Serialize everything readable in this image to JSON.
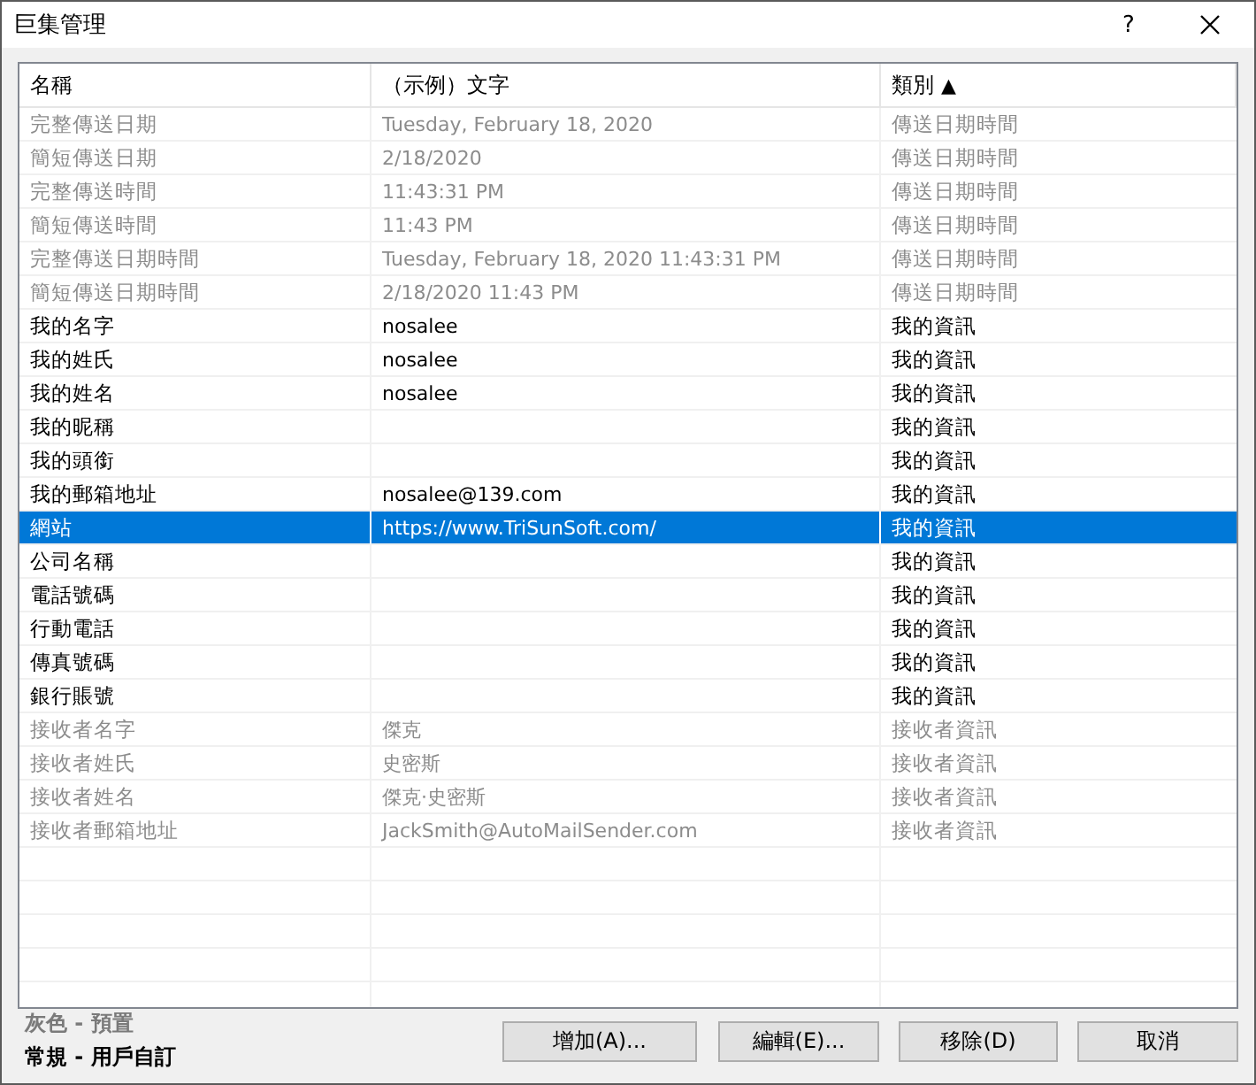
{
  "window": {
    "title": "巨集管理",
    "help": "?"
  },
  "table": {
    "columns": [
      {
        "label": "名稱"
      },
      {
        "label": "（示例）文字"
      },
      {
        "label": "類別",
        "sort_indicator": "▲"
      }
    ],
    "rows": [
      {
        "cells": [
          "完整傳送日期",
          "Tuesday, February 18, 2020",
          "傳送日期時間"
        ],
        "preset": true,
        "selected": false
      },
      {
        "cells": [
          "簡短傳送日期",
          "2/18/2020",
          "傳送日期時間"
        ],
        "preset": true,
        "selected": false
      },
      {
        "cells": [
          "完整傳送時間",
          "11:43:31 PM",
          "傳送日期時間"
        ],
        "preset": true,
        "selected": false
      },
      {
        "cells": [
          "簡短傳送時間",
          "11:43 PM",
          "傳送日期時間"
        ],
        "preset": true,
        "selected": false
      },
      {
        "cells": [
          "完整傳送日期時間",
          "Tuesday, February 18, 2020 11:43:31 PM",
          "傳送日期時間"
        ],
        "preset": true,
        "selected": false
      },
      {
        "cells": [
          "簡短傳送日期時間",
          "2/18/2020 11:43 PM",
          "傳送日期時間"
        ],
        "preset": true,
        "selected": false
      },
      {
        "cells": [
          "我的名字",
          "nosalee",
          "我的資訊"
        ],
        "preset": false,
        "selected": false
      },
      {
        "cells": [
          "我的姓氏",
          "nosalee",
          "我的資訊"
        ],
        "preset": false,
        "selected": false
      },
      {
        "cells": [
          "我的姓名",
          "nosalee",
          "我的資訊"
        ],
        "preset": false,
        "selected": false
      },
      {
        "cells": [
          "我的昵稱",
          null,
          "我的資訊"
        ],
        "preset": false,
        "selected": false
      },
      {
        "cells": [
          "我的頭銜",
          null,
          "我的資訊"
        ],
        "preset": false,
        "selected": false
      },
      {
        "cells": [
          "我的郵箱地址",
          "nosalee@139.com",
          "我的資訊"
        ],
        "preset": false,
        "selected": false
      },
      {
        "cells": [
          "網站",
          "https://www.TriSunSoft.com/",
          "我的資訊"
        ],
        "preset": false,
        "selected": true
      },
      {
        "cells": [
          "公司名稱",
          null,
          "我的資訊"
        ],
        "preset": false,
        "selected": false
      },
      {
        "cells": [
          "電話號碼",
          null,
          "我的資訊"
        ],
        "preset": false,
        "selected": false
      },
      {
        "cells": [
          "行動電話",
          null,
          "我的資訊"
        ],
        "preset": false,
        "selected": false
      },
      {
        "cells": [
          "傳真號碼",
          null,
          "我的資訊"
        ],
        "preset": false,
        "selected": false
      },
      {
        "cells": [
          "銀行賬號",
          null,
          "我的資訊"
        ],
        "preset": false,
        "selected": false
      },
      {
        "cells": [
          "接收者名字",
          "傑克",
          "接收者資訊"
        ],
        "preset": true,
        "selected": false
      },
      {
        "cells": [
          "接收者姓氏",
          "史密斯",
          "接收者資訊"
        ],
        "preset": true,
        "selected": false
      },
      {
        "cells": [
          "接收者姓名",
          "傑克·史密斯",
          "接收者資訊"
        ],
        "preset": true,
        "selected": false
      },
      {
        "cells": [
          "接收者郵箱地址",
          "JackSmith@AutoMailSender.com",
          "接收者資訊"
        ],
        "preset": true,
        "selected": false
      }
    ]
  },
  "legend": [
    {
      "label": "灰色 - 預置",
      "preset": true
    },
    {
      "label": "常規 - 用戶自訂",
      "preset": false
    }
  ],
  "buttons": [
    "增加(A)...",
    "編輯(E)...",
    "移除(D)",
    "取消"
  ]
}
